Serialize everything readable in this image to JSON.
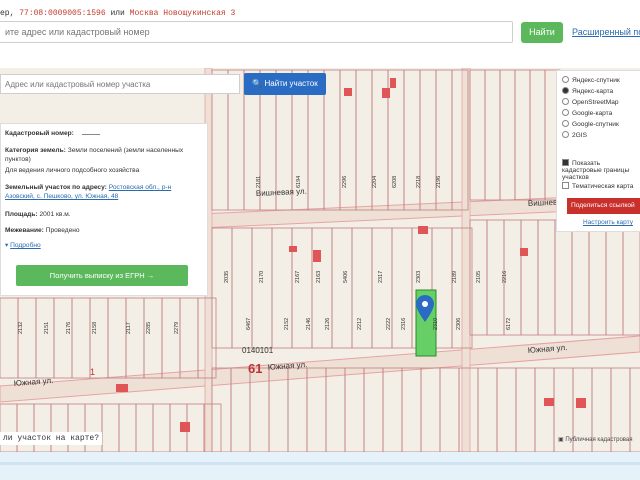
{
  "header": {
    "example_prefix": "ер,",
    "example_cadastral": "77:08:0009005:1596",
    "example_or": "или",
    "example_address": "Москва Новощукинская 3",
    "search_placeholder": "ите адрес или кадастровый номер",
    "find_label": "Найти",
    "advanced_link": "Расширенный пои"
  },
  "parcel_search": {
    "placeholder": "Адрес или кадастровый номер участка",
    "button_label": "Найти участок"
  },
  "info_panel": {
    "cadastral_label": "Кадастровый номер:",
    "category_label": "Категория земель:",
    "category_value": "Земли поселений (земли населенных пунктов)",
    "usage_value": "Для ведения личного подсобного хозяйства",
    "address_label": "Земельный участок по адресу:",
    "address_value": "Ростовская обл., р-н Азовский, с. Пешково, ул. Южная, 48",
    "area_label": "Площадь:",
    "area_value": "2001 кв.м.",
    "survey_label": "Межевание:",
    "survey_value": "Проведено",
    "more_link": "Подробно",
    "egrn_button": "Получить выписку из ЕГРН →"
  },
  "layers": {
    "options": [
      "Яндекс-спутник",
      "Яндекс-карта",
      "OpenStreetMap",
      "Google-карта",
      "Google-спутник",
      "2GIS"
    ],
    "selected": "Яндекс-карта",
    "checkbox1": "Показать кадастровые границы участков",
    "checkbox2": "Тематическая карта",
    "share_button": "Поделиться ссылкой",
    "setup_link": "Настроить карту"
  },
  "map": {
    "street_1": "Вишневая ул.",
    "street_2": "Вишнева",
    "street_3": "Южная ул.",
    "street_4": "Южная ул.",
    "street_5": "Южная ул.",
    "block_id": "0140101",
    "block_num": "61",
    "small_num": "1",
    "attribution": "Публичная кадастровая",
    "parcel_numbers": [
      "2035",
      "2170",
      "2167",
      "2163",
      "5406",
      "2317",
      "2303",
      "2189",
      "2105",
      "2216",
      "6467",
      "2152",
      "2146",
      "2126",
      "2212",
      "2222",
      "2316",
      "2310",
      "2306",
      "6172",
      "2132",
      "2151",
      "2176",
      "2158",
      "2117",
      "2285",
      "2279",
      "2181",
      "6194",
      "2296",
      "2204",
      "6208",
      "2218",
      "2196"
    ]
  },
  "question_text": "ли участок на карте?",
  "colors": {
    "accent_green": "#5cb85c",
    "accent_blue": "#2a6cc4",
    "share_red": "#c9302c",
    "selected_parcel": "#66d066"
  }
}
